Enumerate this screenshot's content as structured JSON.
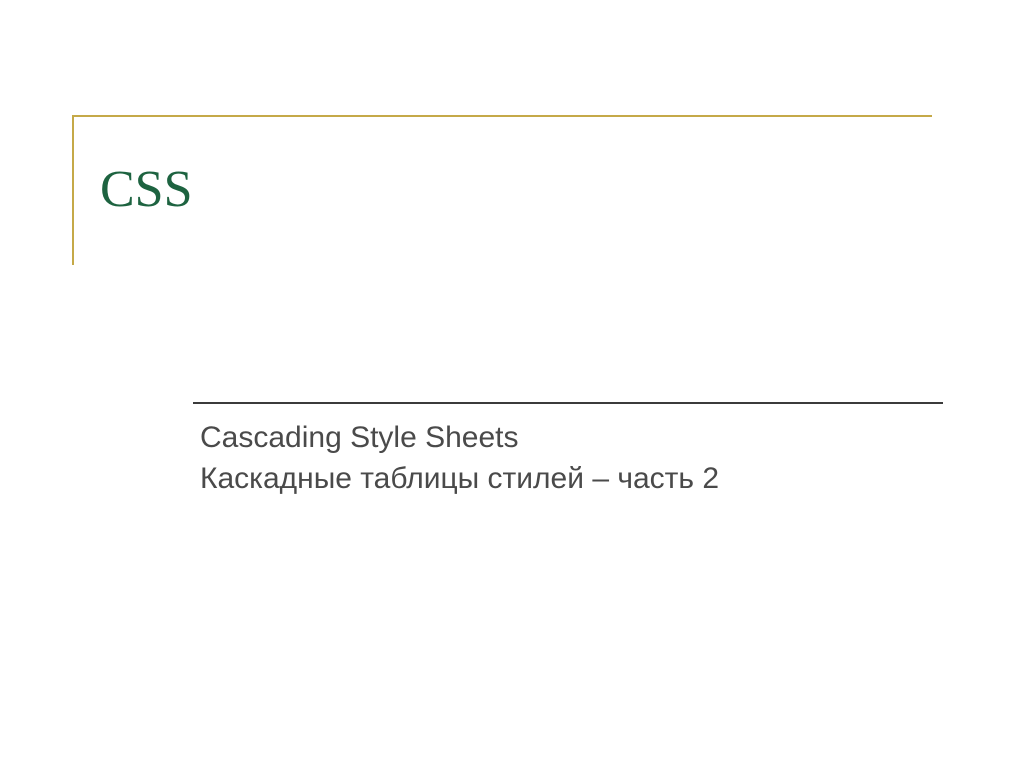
{
  "slide": {
    "title": "CSS",
    "subtitle_line1": "Cascading Style Sheets",
    "subtitle_line2": "Каскадные таблицы стилей – часть 2"
  }
}
